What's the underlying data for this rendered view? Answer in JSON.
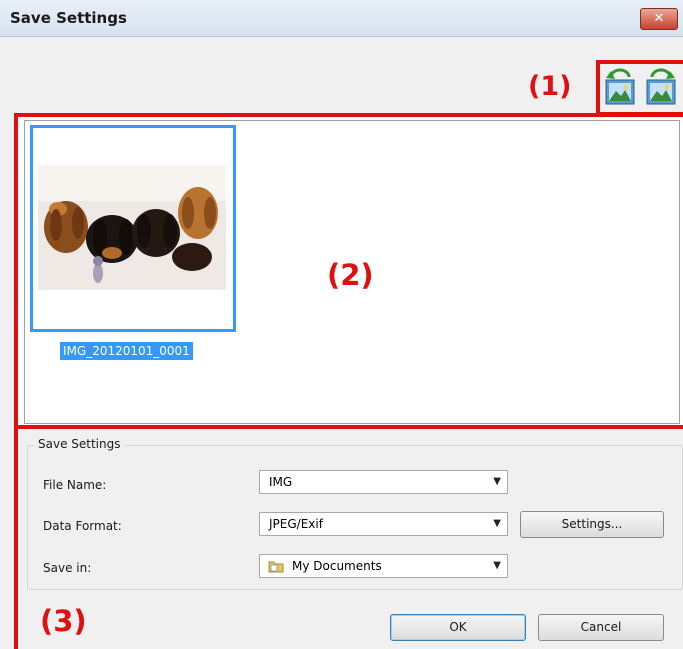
{
  "window": {
    "title": "Save Settings",
    "close_glyph": "✕"
  },
  "callouts": {
    "toolbar": "(1)",
    "preview": "(2)",
    "settings": "(3)"
  },
  "toolbar": {
    "icons": [
      "rotate-left-icon",
      "rotate-right-icon"
    ]
  },
  "preview": {
    "items": [
      {
        "file_name": "IMG_20120101_0001",
        "selected": true
      }
    ]
  },
  "save_settings": {
    "group_title": "Save Settings",
    "file_name_label": "File Name:",
    "file_name_value": "IMG",
    "data_format_label": "Data Format:",
    "data_format_value": "JPEG/Exif",
    "settings_button": "Settings...",
    "save_in_label": "Save in:",
    "save_in_value": "My Documents"
  },
  "buttons": {
    "ok": "OK",
    "cancel": "Cancel"
  },
  "colors": {
    "callout": "#e01010",
    "selection": "#3399ff"
  }
}
